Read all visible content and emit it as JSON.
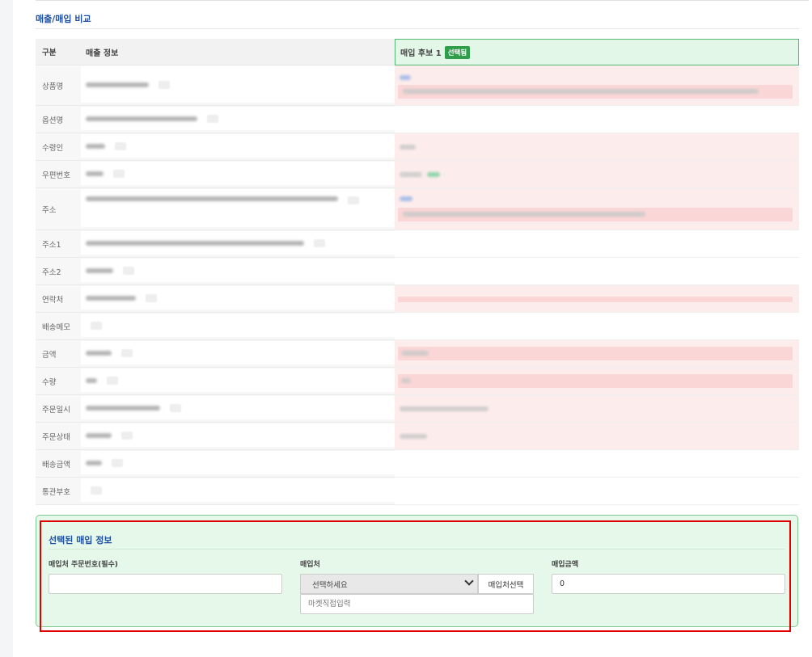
{
  "section_title": "매출/매입 비교",
  "headers": {
    "category": "구분",
    "sales": "매출 정보",
    "purchase": "매입 후보 1",
    "selected_badge": "선택됨"
  },
  "rows": [
    {
      "label": "상품명"
    },
    {
      "label": "옵션명"
    },
    {
      "label": "수령인"
    },
    {
      "label": "우편번호"
    },
    {
      "label": "주소"
    },
    {
      "label": "주소1"
    },
    {
      "label": "주소2"
    },
    {
      "label": "연락처"
    },
    {
      "label": "배송메모"
    },
    {
      "label": "금액"
    },
    {
      "label": "수량"
    },
    {
      "label": "주문일시"
    },
    {
      "label": "주문상태"
    },
    {
      "label": "배송금액"
    },
    {
      "label": "통관부호"
    }
  ],
  "selected_panel": {
    "title": "선택된 매입 정보",
    "order_no_label": "매입처 주문번호(필수)",
    "order_no_value": "",
    "vendor_label": "매입처",
    "vendor_select": "선택하세요",
    "vendor_button": "매입처선택",
    "market_placeholder": "마켓직접입력",
    "amount_label": "매입금액",
    "amount_value": "0"
  },
  "colors": {
    "accent_blue": "#1e4fa3",
    "selected_green": "#2f9e4a",
    "highlight_red": "#e00000"
  }
}
